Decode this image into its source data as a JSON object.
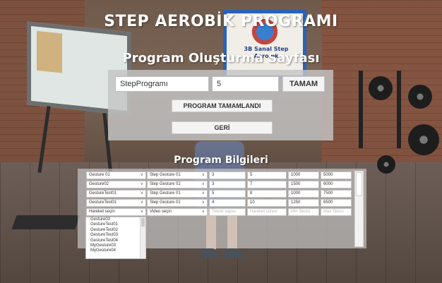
{
  "titles": {
    "main": "STEP AEROBİK PROGRAMI",
    "sub": "Program Oluşturma Sayfası",
    "info": "Program Bilgileri"
  },
  "background_sign": {
    "text": "3B Sanal Step Aerobik"
  },
  "form": {
    "program_name_value": "StepProgramı",
    "count_value": "5",
    "tamam_label": "TAMAM",
    "complete_label": "PROGRAM TAMAMLANDI",
    "back_label": "GERİ"
  },
  "program_rows": [
    {
      "movement": "Gesture 01",
      "video": "Step Gesture 01",
      "c1": "3",
      "c2": "5",
      "c3": "1000",
      "c4": "5000"
    },
    {
      "movement": "Gesture02",
      "video": "Step Gesture 02",
      "c1": "3",
      "c2": "7",
      "c3": "1500",
      "c4": "6000"
    },
    {
      "movement": "GestureTest01",
      "video": "Step Gesture 01",
      "c1": "5",
      "c2": "8",
      "c3": "1000",
      "c4": "7500"
    },
    {
      "movement": "GestureTest01",
      "video": "Step Gesture 01",
      "c1": "4",
      "c2": "10",
      "c3": "1250",
      "c4": "6500"
    }
  ],
  "new_row": {
    "movement_placeholder": "Hareket seçin",
    "video_placeholder": "Video seçin",
    "c1_placeholder": "Tekrar sayısı",
    "c2_placeholder": "Hareket süresi",
    "c3_placeholder": "Min Skoru",
    "c4_placeholder": "Max Skoru"
  },
  "movement_options": [
    "Gesture03",
    "GestureTest01",
    "GestureTest02",
    "GestureTest03",
    "GestureTest04",
    "MyGesture03",
    "MyGesture04"
  ]
}
